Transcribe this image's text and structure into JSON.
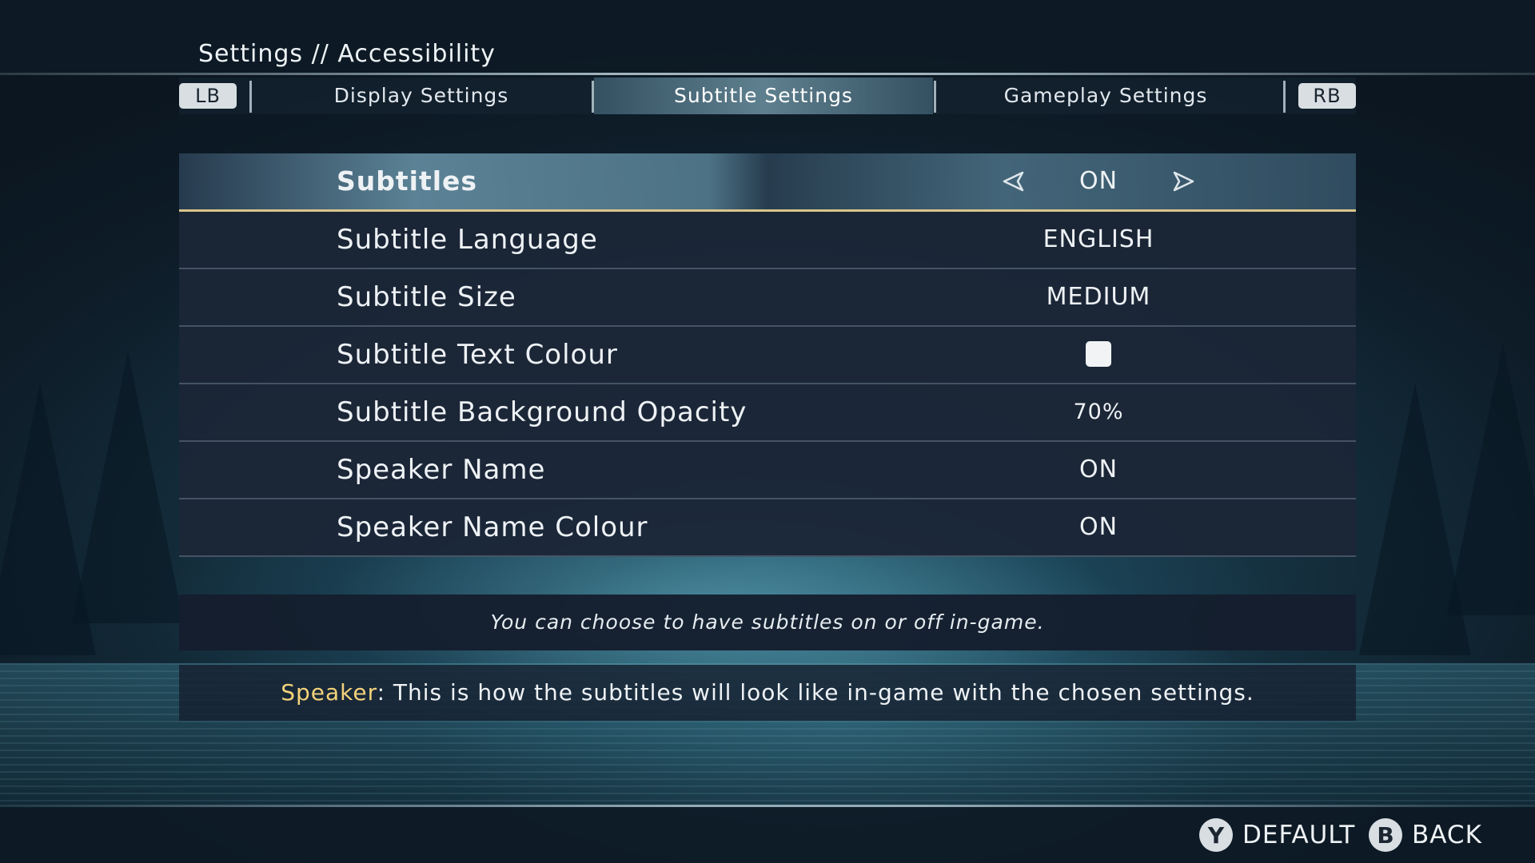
{
  "header": {
    "breadcrumb": "Settings // Accessibility"
  },
  "tabs": {
    "left_bumper": "LB",
    "right_bumper": "RB",
    "items": [
      {
        "label": "Display Settings",
        "active": false
      },
      {
        "label": "Subtitle Settings",
        "active": true
      },
      {
        "label": "Gameplay Settings",
        "active": false
      }
    ]
  },
  "settings": {
    "rows": [
      {
        "label": "Subtitles",
        "value": "ON",
        "selected": true
      },
      {
        "label": "Subtitle Language",
        "value": "ENGLISH"
      },
      {
        "label": "Subtitle Size",
        "value": "MEDIUM"
      },
      {
        "label": "Subtitle Text Colour",
        "value": "",
        "swatch_color": "#f1f3f5"
      },
      {
        "label": "Subtitle Background Opacity",
        "value": "70%"
      },
      {
        "label": "Speaker Name",
        "value": "ON"
      },
      {
        "label": "Speaker Name Colour",
        "value": "ON"
      }
    ]
  },
  "description": "You can choose to have subtitles on or off in-game.",
  "preview": {
    "speaker": "Speaker",
    "text": ": This is how the subtitles will look like in-game with the chosen settings."
  },
  "footer": {
    "default": {
      "button": "Y",
      "label": "DEFAULT"
    },
    "back": {
      "button": "B",
      "label": "BACK"
    }
  },
  "colors": {
    "accent_underline": "#d9c58a",
    "speaker_name": "#f3d27a"
  }
}
